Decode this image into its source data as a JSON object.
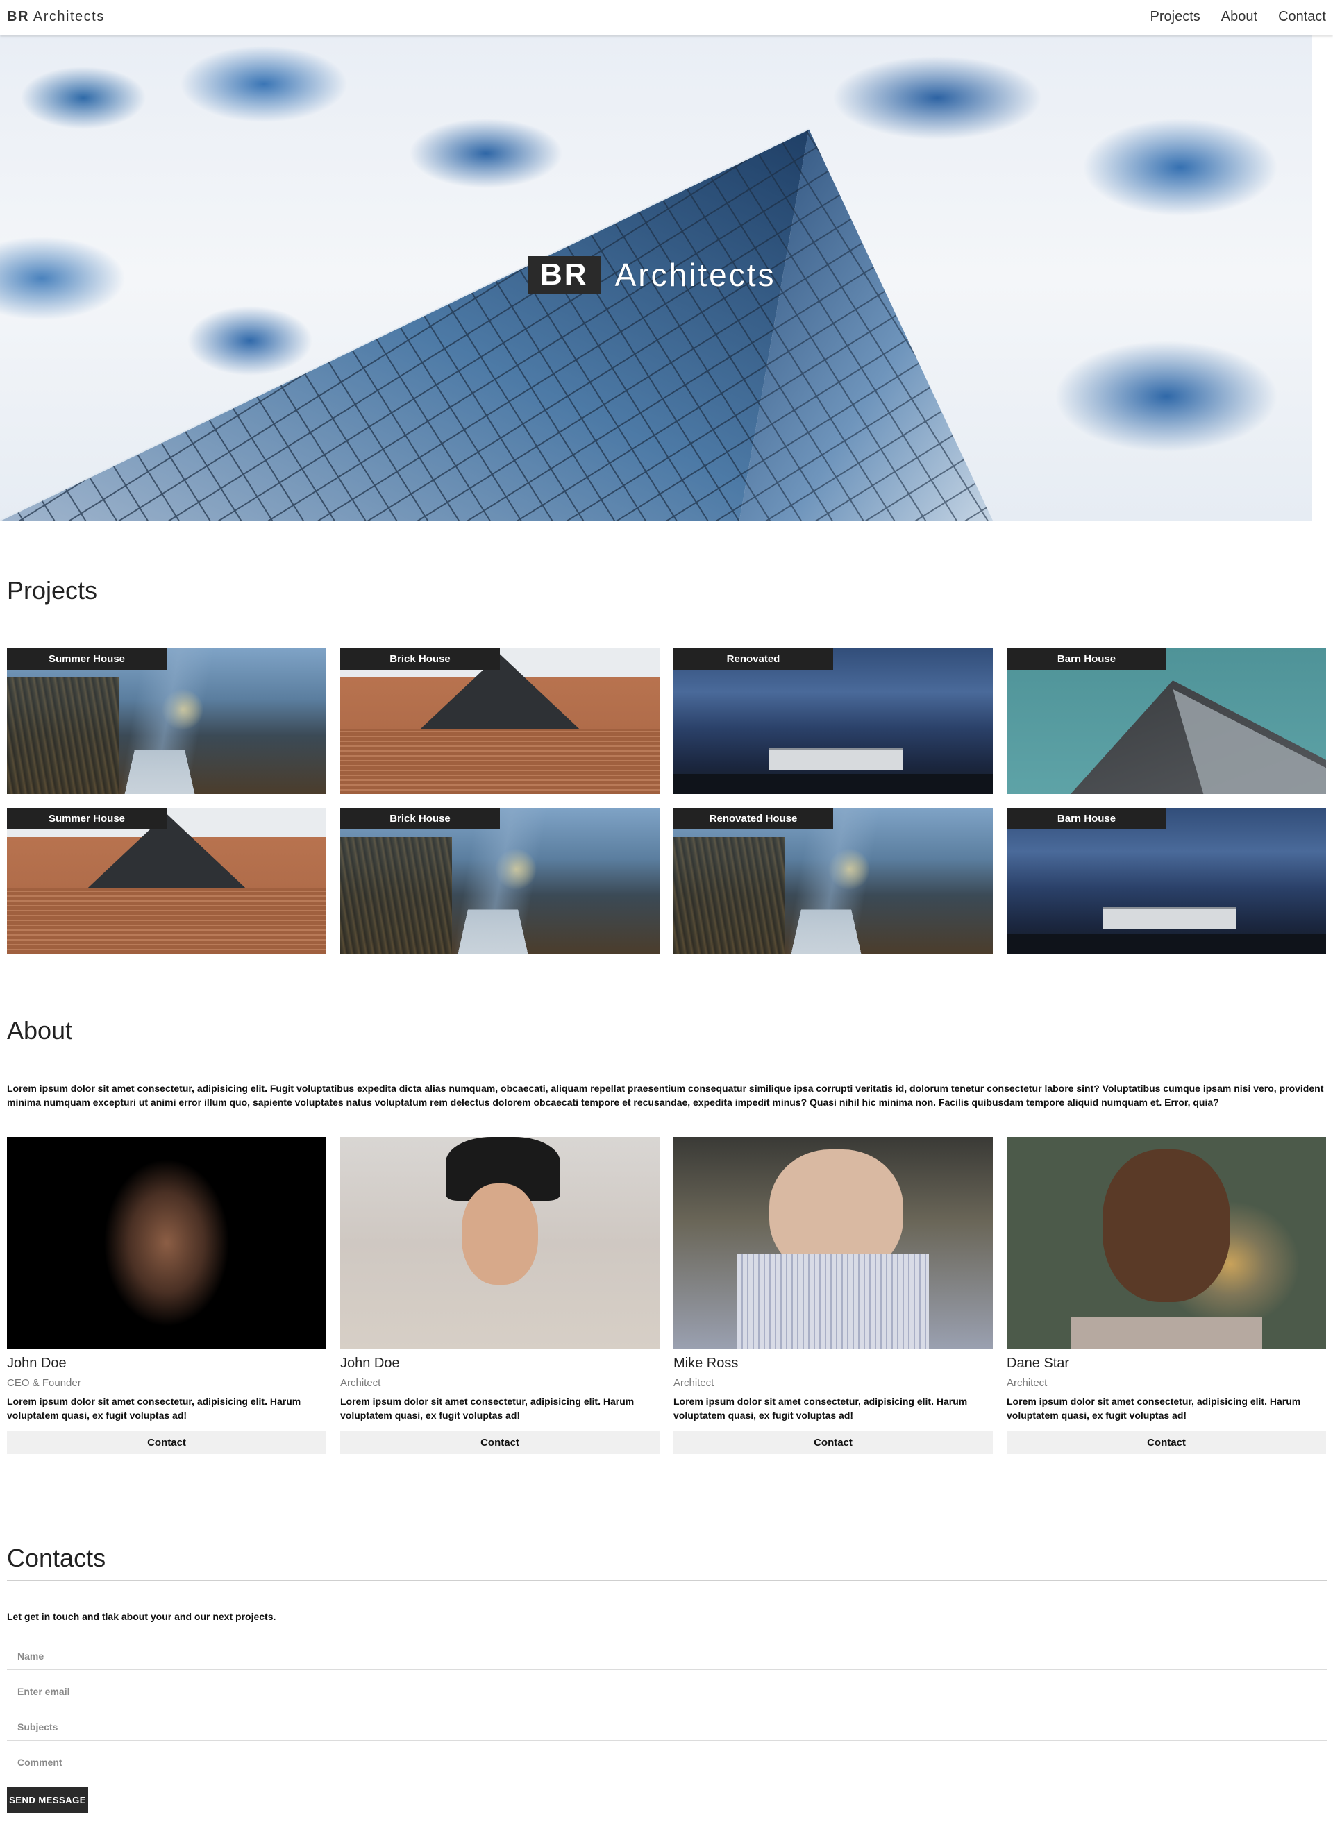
{
  "nav": {
    "brand_bold": "BR",
    "brand_text": "Architects",
    "links": [
      "Projects",
      "About",
      "Contact"
    ]
  },
  "hero": {
    "title_bold": "BR",
    "title_text": "Architects"
  },
  "projects": {
    "title": "Projects",
    "items": [
      {
        "label": "Summer House",
        "image": "walkway-house-photo"
      },
      {
        "label": "Brick House",
        "image": "brick-house-photo"
      },
      {
        "label": "Renovated",
        "image": "night-house-photo"
      },
      {
        "label": "Barn House",
        "image": "barn-house-photo"
      },
      {
        "label": "Summer House",
        "image": "brick-house-photo"
      },
      {
        "label": "Brick House",
        "image": "walkway-house-photo"
      },
      {
        "label": "Renovated House",
        "image": "walkway-house-photo"
      },
      {
        "label": "Barn House",
        "image": "night-house-photo"
      }
    ]
  },
  "about": {
    "title": "About",
    "text": "Lorem ipsum dolor sit amet consectetur, adipisicing elit. Fugit voluptatibus expedita dicta alias numquam, obcaecati, aliquam repellat praesentium consequatur similique ipsa corrupti veritatis id, dolorum tenetur consectetur labore sint? Voluptatibus cumque ipsam nisi vero, provident minima numquam excepturi ut animi error illum quo, sapiente voluptates natus voluptatum rem delectus dolorem obcaecati tempore et recusandae, expedita impedit minus? Quasi nihil hic minima non. Facilis quibusdam tempore aliquid numquam et. Error, quia?",
    "team": [
      {
        "name": "John Doe",
        "role": "CEO & Founder",
        "desc": "Lorem ipsum dolor sit amet consectetur, adipisicing elit. Harum voluptatem quasi, ex fugit voluptas ad!",
        "button": "Contact"
      },
      {
        "name": "John Doe",
        "role": "Architect",
        "desc": "Lorem ipsum dolor sit amet consectetur, adipisicing elit. Harum voluptatem quasi, ex fugit voluptas ad!",
        "button": "Contact"
      },
      {
        "name": "Mike Ross",
        "role": "Architect",
        "desc": "Lorem ipsum dolor sit amet consectetur, adipisicing elit. Harum voluptatem quasi, ex fugit voluptas ad!",
        "button": "Contact"
      },
      {
        "name": "Dane Star",
        "role": "Architect",
        "desc": "Lorem ipsum dolor sit amet consectetur, adipisicing elit. Harum voluptatem quasi, ex fugit voluptas ad!",
        "button": "Contact"
      }
    ]
  },
  "contacts": {
    "title": "Contacts",
    "lead": "Let get in touch and tlak about your and our next projects.",
    "fields": {
      "name_placeholder": "Name",
      "email_placeholder": "Enter email",
      "subject_placeholder": "Subjects",
      "comment_placeholder": "Comment"
    },
    "submit_label": "SEND MESSAGE"
  },
  "colors": {
    "dark": "#2a2a2a",
    "label_bg": "#222222",
    "button_bg": "#f0f0f0"
  }
}
